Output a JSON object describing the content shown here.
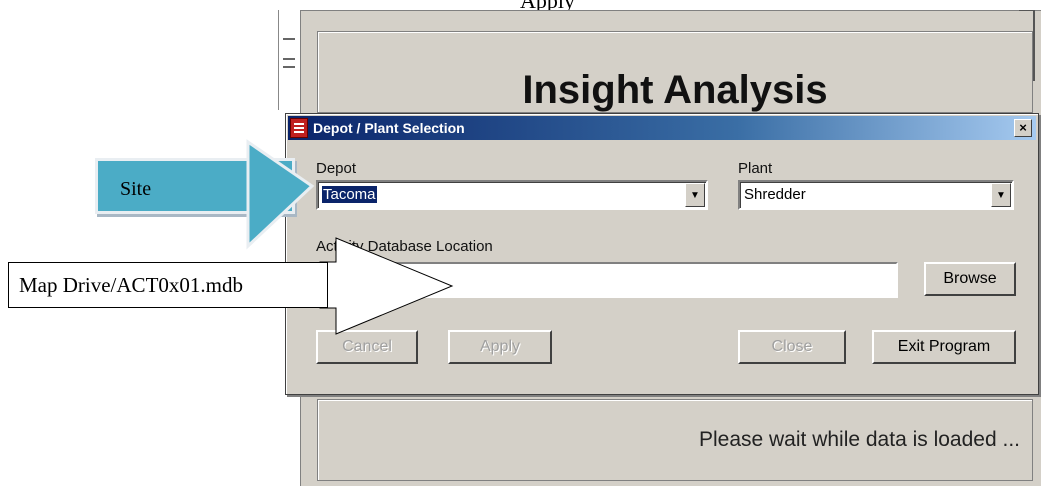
{
  "top_caption": "Apply",
  "background_app": {
    "title": "Insight Analysis",
    "status": "Please wait while data is loaded ..."
  },
  "dialog": {
    "title": "Depot / Plant Selection",
    "close_label": "×",
    "depot_label": "Depot",
    "depot_value": "Tacoma",
    "plant_label": "Plant",
    "plant_value": "Shredder",
    "db_label": "Activity Database Location",
    "db_value": "",
    "browse_label": "Browse",
    "cancel_label": "Cancel",
    "apply_label": "Apply",
    "close_button_label": "Close",
    "exit_label": "Exit Program"
  },
  "annotations": {
    "site_callout": "Site",
    "map_callout": "Map Drive/ACT0x01.mdb"
  },
  "colors": {
    "callout_fill": "#4bacc6",
    "titlebar_dark": "#0a246a",
    "dialog_face": "#d4d0c8"
  }
}
